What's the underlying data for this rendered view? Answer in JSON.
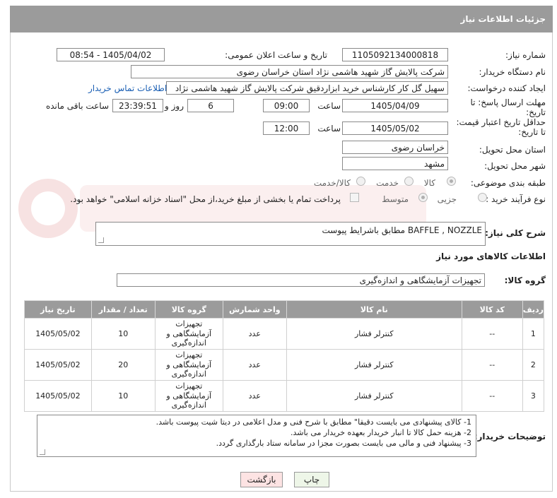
{
  "header": {
    "title": "جزئیات اطلاعات نیاز"
  },
  "fields": {
    "need_number_label": "شماره نیاز:",
    "need_number": "1105092134000818",
    "announce_label": "تاریخ و ساعت اعلان عمومی:",
    "announce_value": "1405/04/02 - 08:54",
    "buyer_org_label": "نام دستگاه خریدار:",
    "buyer_org": "شرکت پالایش گاز شهید هاشمی نژاد   استان خراسان رضوی",
    "requester_label": "ایجاد کننده درخواست:",
    "requester": "سهیل گل کار کارشناس خرید ابزاردقیق شرکت پالایش گاز شهید هاشمی نژاد",
    "contact_link": "اطلاعات تماس خریدار",
    "deadline_label": "مهلت ارسال پاسخ: تا تاریخ:",
    "deadline_date": "1405/04/09",
    "time_label": "ساعت",
    "deadline_time": "09:00",
    "days_value": "6",
    "days_label": "روز و",
    "remaining_time": "23:39:51",
    "remaining_label": "ساعت باقی مانده",
    "validity_label": "حداقل تاریخ اعتبار قیمت: تا تاریخ:",
    "validity_date": "1405/05/02",
    "validity_time": "12:00",
    "province_label": "استان محل تحویل:",
    "province": "خراسان رضوی",
    "city_label": "شهر محل تحویل:",
    "city": "مشهد",
    "category_label": "طبقه بندی موضوعی:",
    "category_options": [
      "کالا",
      "خدمت",
      "کالا/خدمت"
    ],
    "purchase_type_label": "نوع فرآیند خرید :",
    "purchase_options": [
      "جزیی",
      "متوسط"
    ],
    "payment_note": "پرداخت تمام یا بخشی از مبلغ خرید،از محل \"اسناد خزانه اسلامی\" خواهد بود.",
    "summary_label": "شرح کلی نیاز:",
    "summary": "BAFFLE , NOZZLE مطابق باشرایط پیوست"
  },
  "goods": {
    "section_title": "اطلاعات کالاهای مورد نیاز",
    "group_label": "گروه کالا:",
    "group_value": "تجهیزات آزمایشگاهی و اندازه‌گیری",
    "columns": [
      "ردیف",
      "کد کالا",
      "نام کالا",
      "واحد شمارش",
      "گروه کالا",
      "تعداد / مقدار",
      "تاریخ نیاز"
    ],
    "rows": [
      {
        "row": "1",
        "code": "--",
        "name": "کنترلر فشار",
        "unit": "عدد",
        "group": "تجهیزات آزمایشگاهی و اندازه‌گیری",
        "qty": "10",
        "date": "1405/05/02"
      },
      {
        "row": "2",
        "code": "--",
        "name": "کنترلر فشار",
        "unit": "عدد",
        "group": "تجهیزات آزمایشگاهی و اندازه‌گیری",
        "qty": "20",
        "date": "1405/05/02"
      },
      {
        "row": "3",
        "code": "--",
        "name": "کنترلر فشار",
        "unit": "عدد",
        "group": "تجهیزات آزمایشگاهی و اندازه‌گیری",
        "qty": "10",
        "date": "1405/05/02"
      }
    ]
  },
  "notes": {
    "label": "توضیحات خریدار:",
    "lines": [
      "1-    کالای پیشنهادی می بایست دقیقا\" مطابق با شرح فنی و مدل اعلامی در دیتا شیت پیوست باشد.",
      "2-    هزینه حمل کالا تا انبار خریدار بعهده خریدار می باشد.",
      "3-    پیشنهاد فنی و مالی می بایست بصورت مجزا در سامانه ستاد بارگذاری گردد."
    ]
  },
  "buttons": {
    "print": "چاپ",
    "back": "بازگشت"
  },
  "colors": {
    "header_bg": "#9b9b9b",
    "link": "#1a5fb4",
    "back_bg": "#fde3e3",
    "print_bg": "#eef6e8"
  }
}
